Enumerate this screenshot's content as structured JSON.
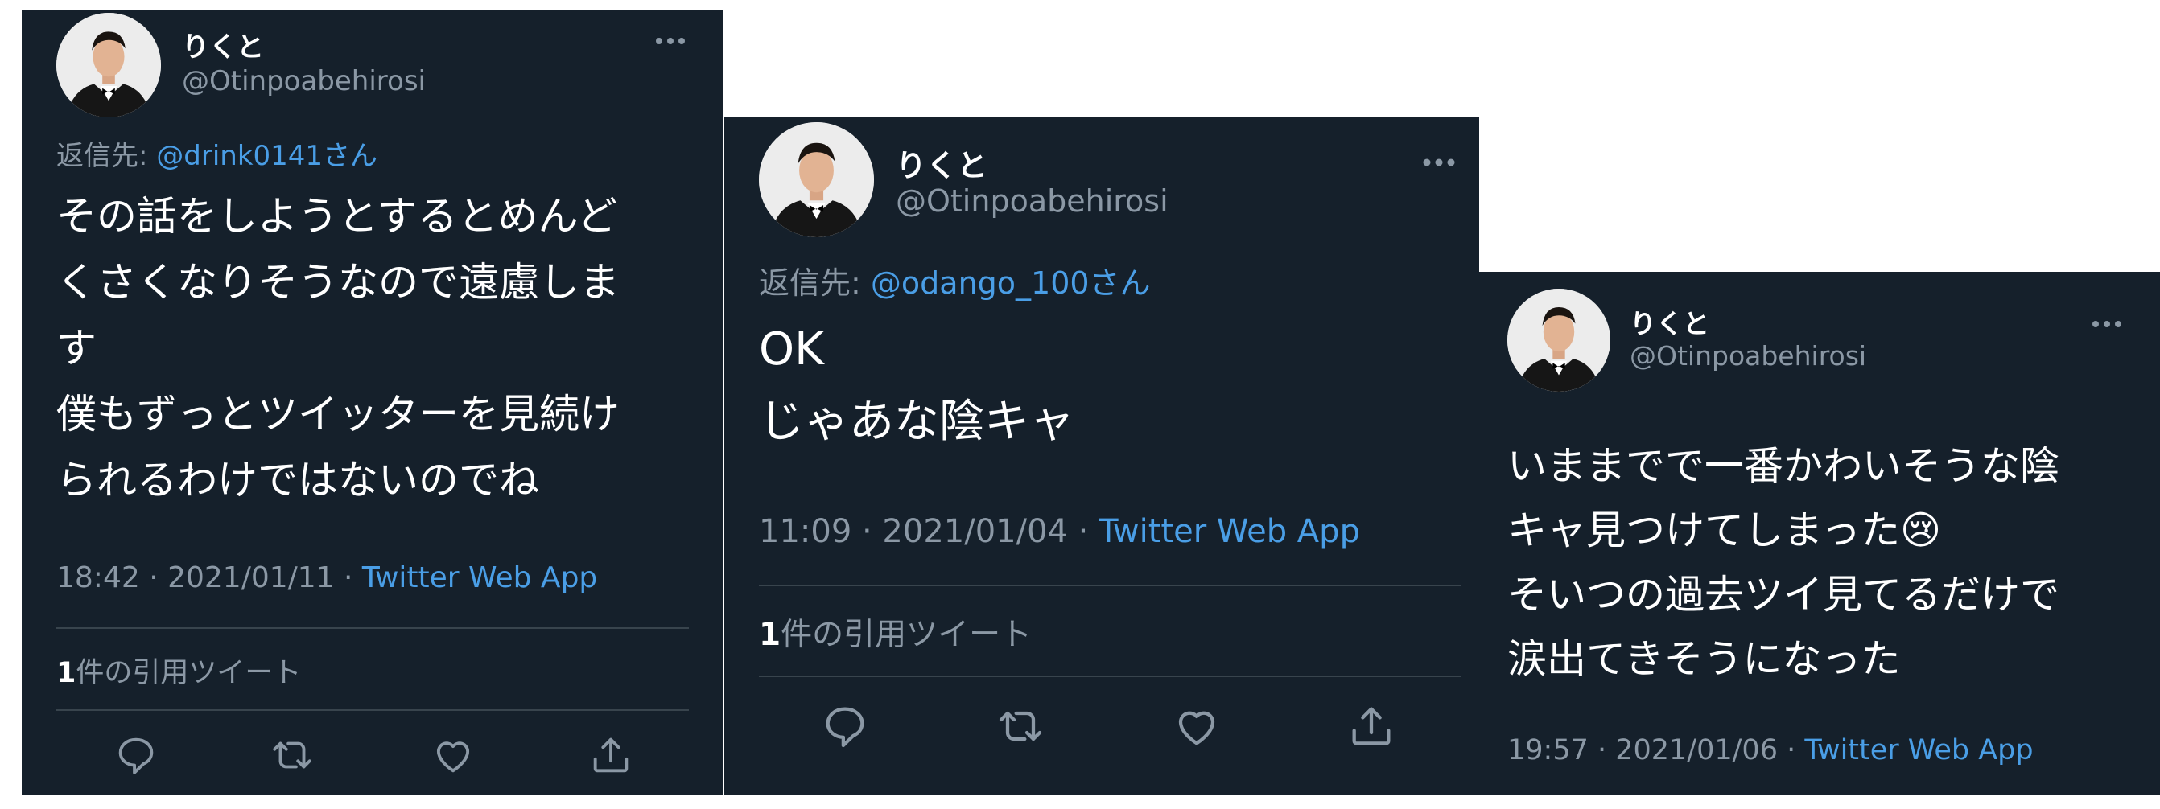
{
  "colors": {
    "background": "#15202b",
    "text": "#ffffff",
    "muted": "#8b98a5",
    "accent": "#4a9ee6",
    "divider": "#38444d"
  },
  "tweets": [
    {
      "display_name": "りくと",
      "handle": "@Otinpoabehirosi",
      "more_icon": "more-horizontal-icon",
      "reply_prefix": "返信先:",
      "reply_mention": "@drink0141さん",
      "body_lines": [
        "その話をしようとするとめんど",
        "くさくなりそうなので遠慮しま",
        "す",
        "僕もずっとツイッターを見続け",
        "られるわけではないのでね"
      ],
      "time": "18:42 · 2021/01/11 · ",
      "source": "Twitter Web App",
      "quote_count": "1",
      "quote_label": "件の引用ツイート",
      "actions": [
        "reply-icon",
        "retweet-icon",
        "like-icon",
        "share-icon"
      ]
    },
    {
      "display_name": "りくと",
      "handle": "@Otinpoabehirosi",
      "more_icon": "more-horizontal-icon",
      "reply_prefix": "返信先:",
      "reply_mention": "@odango_100さん",
      "body_lines": [
        "OK",
        "じゃあな陰キャ"
      ],
      "time": "11:09 · 2021/01/04 · ",
      "source": "Twitter Web App",
      "quote_count": "1",
      "quote_label": "件の引用ツイート",
      "actions": [
        "reply-icon",
        "retweet-icon",
        "like-icon",
        "share-icon"
      ]
    },
    {
      "display_name": "りくと",
      "handle": "@Otinpoabehirosi",
      "more_icon": "more-horizontal-icon",
      "body_lines": [
        "いままでで一番かわいそうな陰",
        "キャ見つけてしまった😢",
        "そいつの過去ツイ見てるだけで",
        "涙出てきそうになった"
      ],
      "time": "19:57 · 2021/01/06 · ",
      "source": "Twitter Web App"
    }
  ]
}
